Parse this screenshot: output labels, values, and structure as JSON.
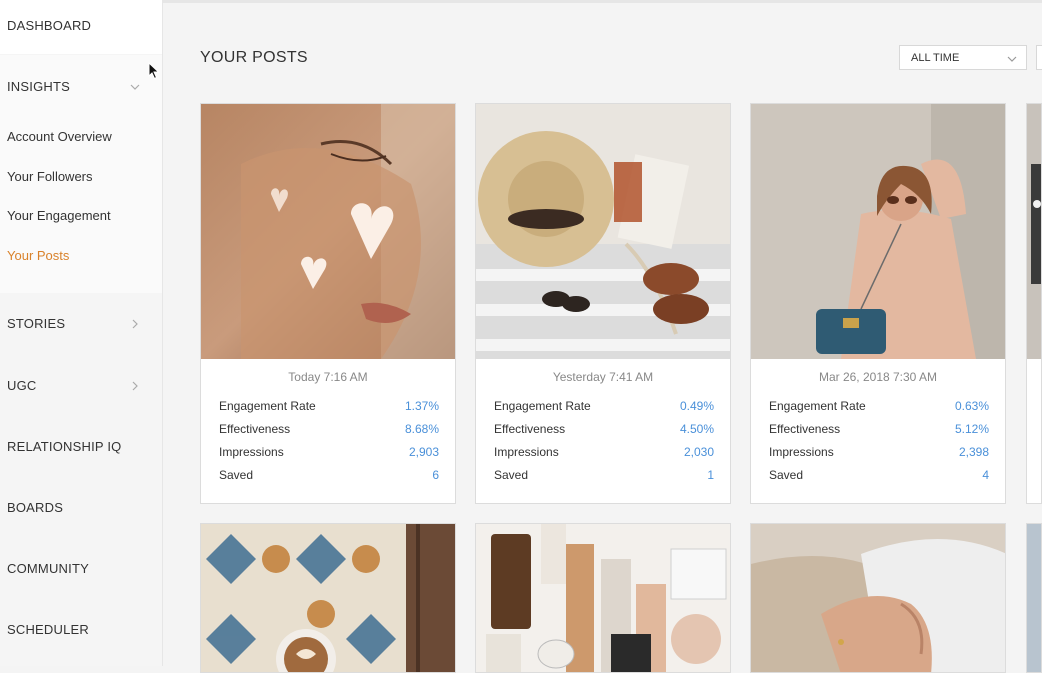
{
  "sidebar": {
    "dashboard": "DASHBOARD",
    "insights": "INSIGHTS",
    "sub_items": [
      "Account Overview",
      "Your Followers",
      "Your Engagement",
      "Your Posts"
    ],
    "active_sub": "Your Posts",
    "stories": "STORIES",
    "ugc": "UGC",
    "relationship_iq": "RELATIONSHIP IQ",
    "boards": "BOARDS",
    "community": "COMMUNITY",
    "scheduler": "SCHEDULER"
  },
  "header": {
    "title": "YOUR POSTS",
    "filter_value": "ALL TIME"
  },
  "posts": [
    {
      "date": "Today 7:16 AM",
      "stats": [
        {
          "label": "Engagement Rate",
          "value": "1.37%"
        },
        {
          "label": "Effectiveness",
          "value": "8.68%"
        },
        {
          "label": "Impressions",
          "value": "2,903"
        },
        {
          "label": "Saved",
          "value": "6"
        }
      ]
    },
    {
      "date": "Yesterday 7:41 AM",
      "stats": [
        {
          "label": "Engagement Rate",
          "value": "0.49%"
        },
        {
          "label": "Effectiveness",
          "value": "4.50%"
        },
        {
          "label": "Impressions",
          "value": "2,030"
        },
        {
          "label": "Saved",
          "value": "1"
        }
      ]
    },
    {
      "date": "Mar 26, 2018 7:30 AM",
      "stats": [
        {
          "label": "Engagement Rate",
          "value": "0.63%"
        },
        {
          "label": "Effectiveness",
          "value": "5.12%"
        },
        {
          "label": "Impressions",
          "value": "2,398"
        },
        {
          "label": "Saved",
          "value": "4"
        }
      ]
    }
  ],
  "colors": {
    "active": "#d9822b",
    "stat_value": "#4a90d9"
  }
}
